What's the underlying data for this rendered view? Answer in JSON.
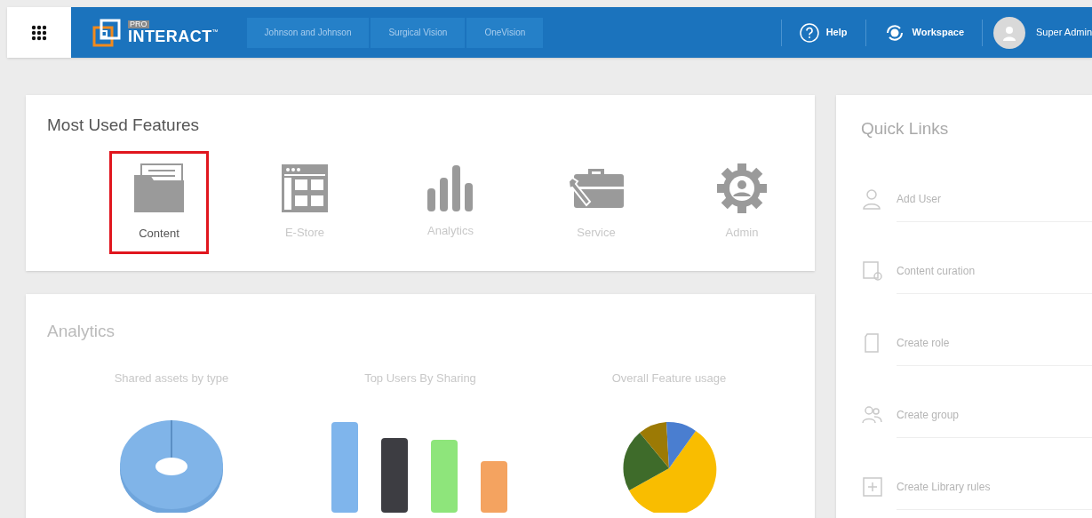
{
  "header": {
    "logo_badge": "PRO",
    "logo_text": "INTERACT",
    "logo_mark": "™",
    "breadcrumbs": [
      "Johnson and Johnson",
      "Surgical Vision",
      "OneVision"
    ],
    "actions": [
      {
        "kind": "help",
        "label": "Help"
      },
      {
        "kind": "workspace",
        "label": "Workspace"
      }
    ],
    "user": {
      "name": "Super Admin"
    }
  },
  "features": {
    "title": "Most Used Features",
    "items": [
      {
        "kind": "content",
        "label": "Content",
        "selected": true
      },
      {
        "kind": "store",
        "label": "E-Store",
        "selected": false
      },
      {
        "kind": "analytics",
        "label": "Analytics",
        "selected": false
      },
      {
        "kind": "service",
        "label": "Service",
        "selected": false
      },
      {
        "kind": "admin",
        "label": "Admin",
        "selected": false
      }
    ]
  },
  "analytics": {
    "title": "Analytics",
    "charts": [
      {
        "kind": "donut",
        "title": "Shared assets by type"
      },
      {
        "kind": "bars",
        "title": "Top Users By Sharing"
      },
      {
        "kind": "pie",
        "title": "Overall Feature usage"
      }
    ]
  },
  "quick_links": {
    "title": "Quick Links",
    "items": [
      {
        "kind": "user",
        "label": "Add User"
      },
      {
        "kind": "curation",
        "label": "Content curation"
      },
      {
        "kind": "role",
        "label": "Create role"
      },
      {
        "kind": "group",
        "label": "Create group"
      },
      {
        "kind": "library",
        "label": "Create Library rules"
      }
    ]
  }
}
